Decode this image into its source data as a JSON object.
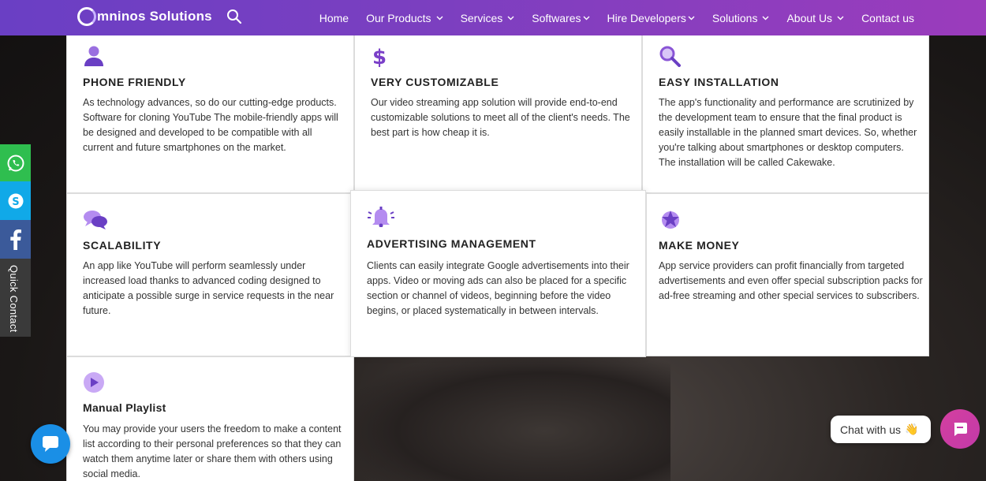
{
  "brand": {
    "logo_text": "mninos Solutions"
  },
  "nav": {
    "items": [
      {
        "label": "Home",
        "dropdown": false
      },
      {
        "label": "Our Products",
        "dropdown": true
      },
      {
        "label": "Services",
        "dropdown": true
      },
      {
        "label": "Softwares",
        "dropdown": true
      },
      {
        "label": "Hire Developers",
        "dropdown": true
      },
      {
        "label": "Solutions",
        "dropdown": true
      },
      {
        "label": "About Us",
        "dropdown": true
      },
      {
        "label": "Contact us",
        "dropdown": false
      }
    ]
  },
  "features": [
    {
      "icon": "user-icon",
      "title": "PHONE FRIENDLY",
      "text": "As technology advances, so do our cutting-edge products. Software for cloning YouTube The mobile-friendly apps will be designed and developed to be compatible with all current and future smartphones on the market."
    },
    {
      "icon": "dollar-icon",
      "title": "VERY CUSTOMIZABLE",
      "text": "Our video streaming app solution will provide end-to-end customizable solutions to meet all of the client's needs. The best part is how cheap it is."
    },
    {
      "icon": "search-icon",
      "title": "EASY INSTALLATION",
      "text": "The app's functionality and performance are scrutinized by the development team to ensure that the final product is easily installable in the planned smart devices. So, whether you're talking about smartphones or desktop computers. The installation will be called Cakewake."
    },
    {
      "icon": "chat-bubbles-icon",
      "title": "SCALABILITY",
      "text": "An app like YouTube will perform seamlessly under increased load thanks to advanced coding designed to anticipate a possible surge in service requests in the near future."
    },
    {
      "icon": "bell-icon",
      "title": "ADVERTISING MANAGEMENT",
      "text": "Clients can easily integrate Google advertisements into their apps. Video or moving ads can also be placed for a specific section or channel of videos, beginning before the video begins, or placed systematically in between intervals."
    },
    {
      "icon": "star-icon",
      "title": "MAKE MONEY",
      "text": "App service providers can profit financially from targeted advertisements and even offer special subscription packs for ad-free streaming and other special services to subscribers."
    },
    {
      "icon": "play-icon",
      "title": "Manual Playlist",
      "text": "You may provide your users the freedom to make a content list according to their personal preferences so that they can watch them anytime later or share them with others using social media."
    }
  ],
  "quick_contact": {
    "label": "Quick Contact"
  },
  "chat": {
    "label": "Chat with us",
    "emoji": "👋"
  },
  "colors": {
    "accent": "#6a3fc4",
    "icon_purple": "#7a4ccc",
    "icon_light": "#b48cf0"
  }
}
